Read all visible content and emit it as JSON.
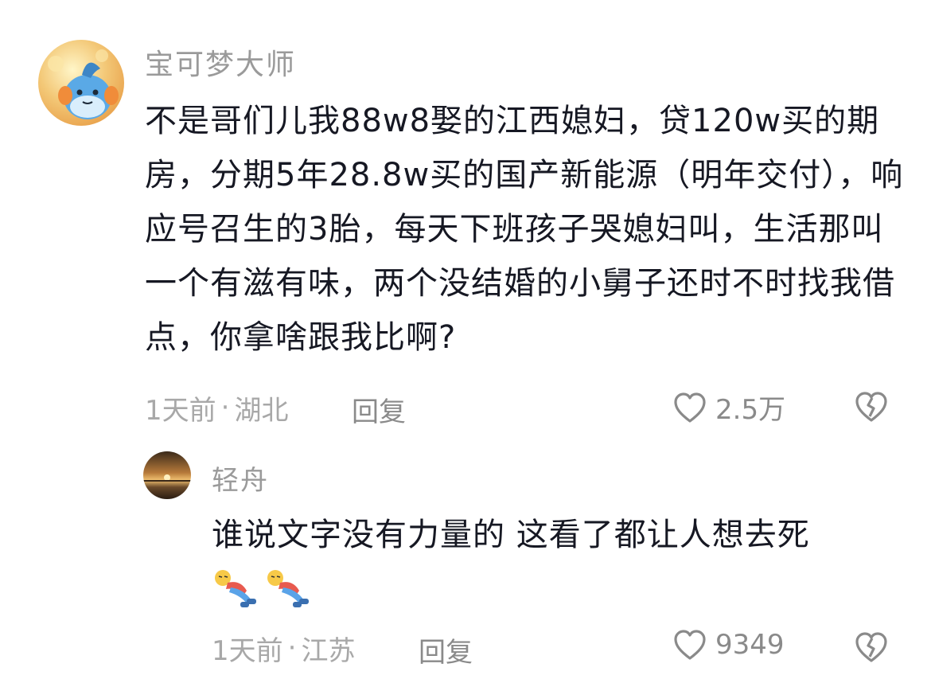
{
  "comments": [
    {
      "username": "宝可梦大师",
      "text": "不是哥们儿我88w8娶的江西媳妇，贷120w买的期房，分期5年28.8w买的国产新能源（明年交付），响应号召生的3胎，每天下班孩子哭媳妇叫，生活那叫一个有滋有味，两个没结婚的小舅子还时不时找我借点，你拿啥跟我比啊?",
      "time": "1天前",
      "separator": "·",
      "location": "湖北",
      "reply_label": "回复",
      "likes": "2.5万",
      "avatar_icon": "mudkip-avatar"
    },
    {
      "username": "轻舟",
      "text": "谁说文字没有力量的 这看了都让人想去死",
      "stickers": [
        "lying-down-emoji",
        "lying-down-emoji"
      ],
      "time": "1天前",
      "separator": "·",
      "location": "江苏",
      "reply_label": "回复",
      "likes": "9349",
      "avatar_icon": "sunset-avatar"
    }
  ],
  "colors": {
    "text": "#161823",
    "username": "#9a9a9a",
    "meta": "#a8a8a8",
    "background": "#ffffff"
  }
}
